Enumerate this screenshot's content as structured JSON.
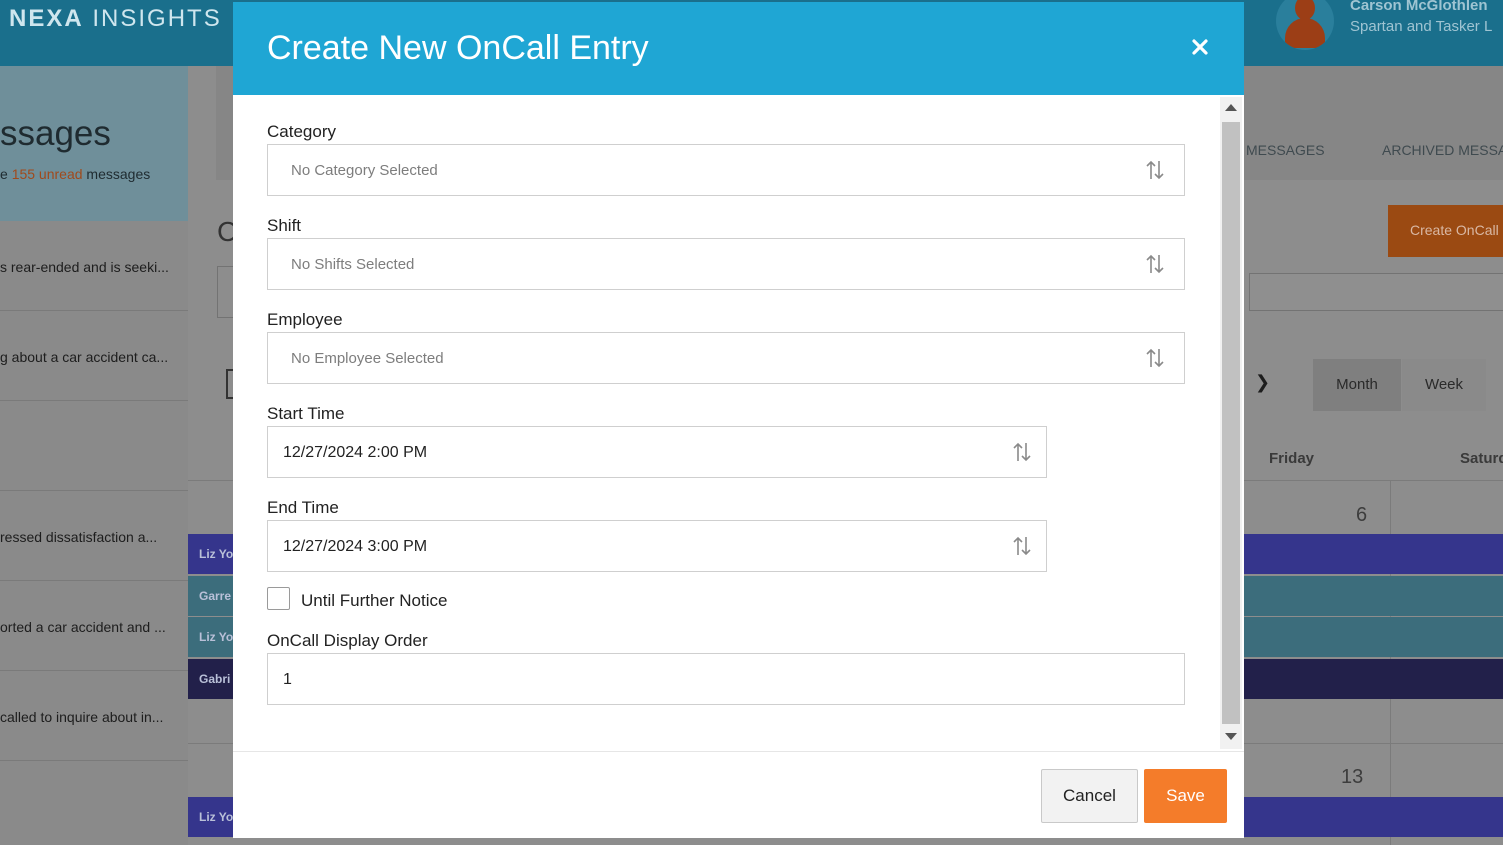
{
  "app": {
    "brand_bold": "NEXA",
    "brand_light": " INSIGHTS",
    "user_name": "Carson McGlothlen",
    "user_org": "Spartan and Tasker L"
  },
  "sidebar": {
    "title": "ssages",
    "sub_prefix": "e ",
    "unread": "155 unread",
    "sub_suffix": " messages",
    "items": [
      {
        "preview": "s rear-ended and is seeki..."
      },
      {
        "preview": "g about a car accident ca..."
      },
      {
        "preview": ""
      },
      {
        "preview": "ressed dissatisfaction a..."
      },
      {
        "preview": "orted a car accident and ..."
      },
      {
        "preview": "called to inquire about in..."
      }
    ]
  },
  "main": {
    "tab_messages": "MESSAGES",
    "tab_archived": "ARCHIVED MESSA",
    "create_button": "Create OnCall",
    "partial_heading": "C",
    "view_month": "Month",
    "view_week": "Week",
    "day_friday": "Friday",
    "day_saturday": "Saturd",
    "date_6": "6",
    "date_13": "13",
    "events": [
      "Liz Yo",
      "Garre",
      "Liz Yo",
      "Gabri",
      "Liz Yo"
    ]
  },
  "modal": {
    "title": "Create New OnCall Entry",
    "category_label": "Category",
    "category_placeholder": "No Category Selected",
    "shift_label": "Shift",
    "shift_placeholder": "No Shifts Selected",
    "employee_label": "Employee",
    "employee_placeholder": "No Employee Selected",
    "start_label": "Start Time",
    "start_value": "12/27/2024 2:00 PM",
    "end_label": "End Time",
    "end_value": "12/27/2024 3:00 PM",
    "until_notice_label": "Until Further Notice",
    "until_notice_checked": false,
    "order_label": "OnCall Display Order",
    "order_value": "1",
    "cancel_label": "Cancel",
    "save_label": "Save"
  },
  "colors": {
    "header": "#1fa6d4",
    "save": "#f47c2a",
    "topbar": "#1a6f8c"
  }
}
